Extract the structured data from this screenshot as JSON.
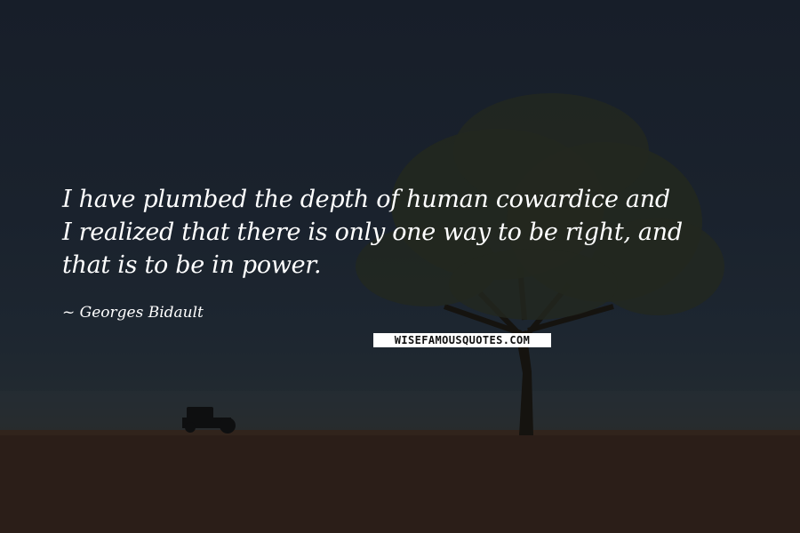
{
  "quote": {
    "lines": [
      "I have plumbed the depth of human cowardice and",
      "I realized that there is only one way to be right, and",
      "that is to be in power."
    ]
  },
  "author": {
    "text": "~ Georges Bidault"
  },
  "brand": {
    "text": "WISEFAMOUSQUOTES.COM"
  },
  "colors": {
    "sky": "#1a222d",
    "ground": "#2a1d17",
    "text": "#ffffff"
  }
}
